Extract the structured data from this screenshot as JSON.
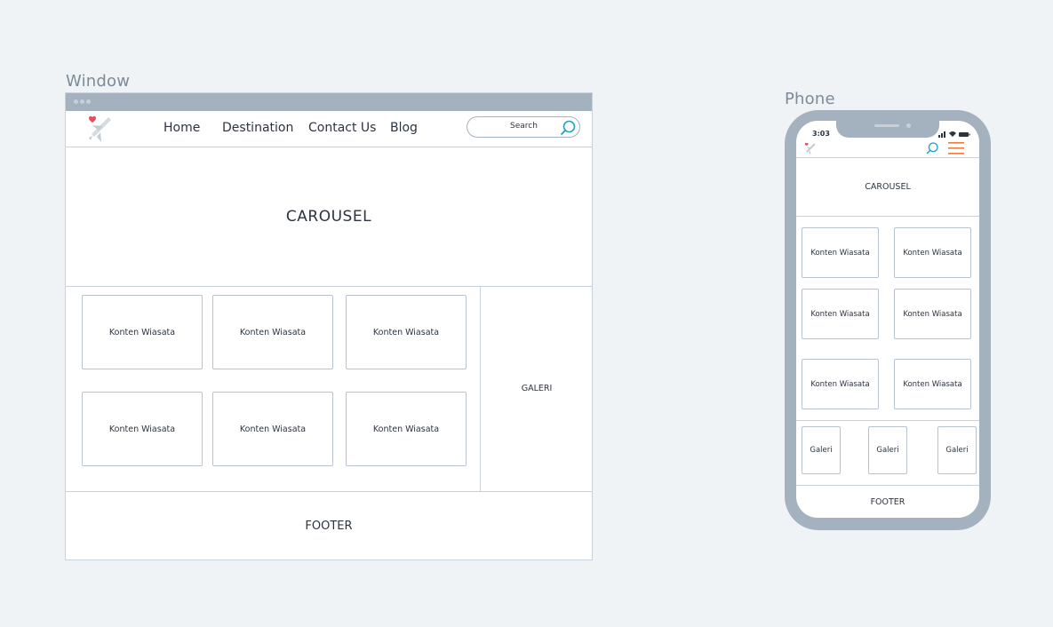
{
  "labels": {
    "window": "Window",
    "phone": "Phone"
  },
  "desktop": {
    "nav": [
      "Home",
      "Destination",
      "Contact Us",
      "Blog"
    ],
    "search": {
      "placeholder": "Search"
    },
    "carousel": "CAROUSEL",
    "cards": [
      "Konten Wiasata",
      "Konten Wiasata",
      "Konten Wiasata",
      "Konten Wiasata",
      "Konten Wiasata",
      "Konten Wiasata"
    ],
    "galeri": "GALERI",
    "footer": "FOOTER"
  },
  "phone": {
    "time": "3:03",
    "carousel": "CAROUSEL",
    "cards": [
      "Konten Wiasata",
      "Konten Wiasata",
      "Konten Wiasata",
      "Konten Wiasata",
      "Konten Wiasata",
      "Konten Wiasata"
    ],
    "galeri": [
      "Galeri",
      "Galeri",
      "Galeri"
    ],
    "footer": "FOOTER"
  },
  "colors": {
    "accent": "#e84a5f",
    "search_icon": "#1aa3c8",
    "menu_icon": "#f07a3a",
    "frame": "#a4b2bf"
  }
}
